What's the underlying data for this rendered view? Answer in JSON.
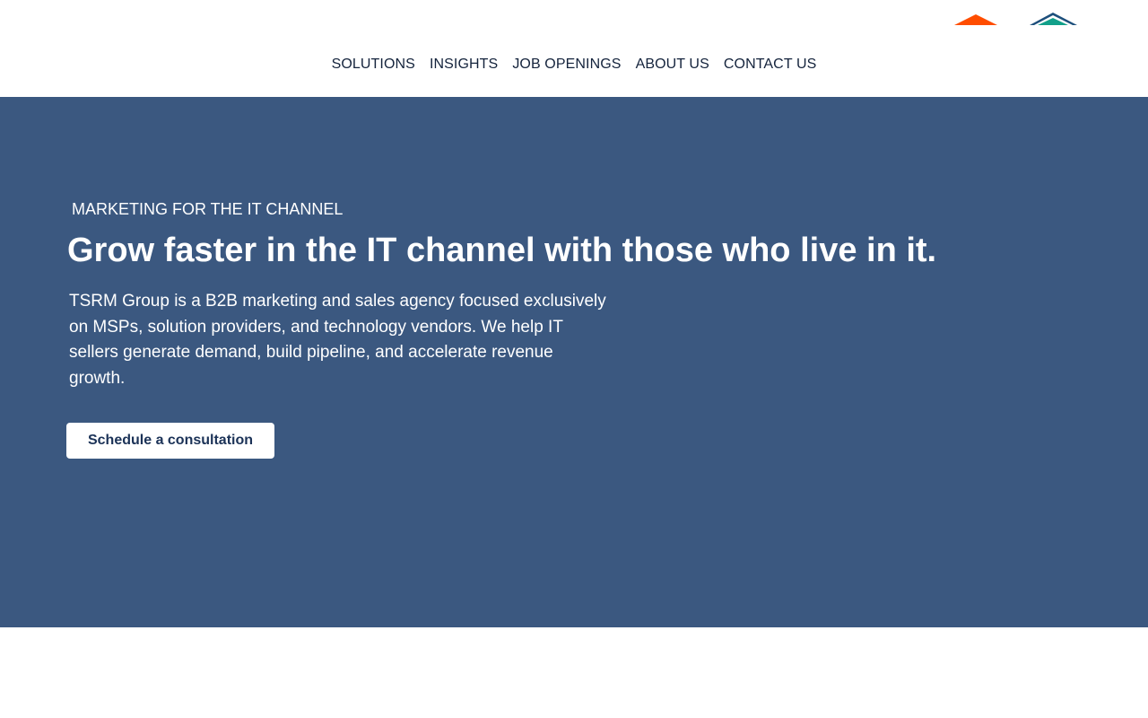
{
  "header": {
    "logo_icons": [
      "orange-roof-icon",
      "teal-roof-icon"
    ],
    "nav": [
      {
        "label": "SOLUTIONS"
      },
      {
        "label": "INSIGHTS"
      },
      {
        "label": "JOB OPENINGS"
      },
      {
        "label": "ABOUT US"
      },
      {
        "label": "CONTACT US"
      }
    ]
  },
  "hero": {
    "eyebrow": "MARKETING FOR THE IT CHANNEL",
    "headline": "Grow faster in the IT channel with those who live in it.",
    "description": "TSRM Group is a B2B marketing and sales agency focused exclusively on MSPs, solution providers, and technology vendors. We help IT sellers generate demand,  build pipeline, and accelerate revenue growth.",
    "cta_label": "Schedule a consultation"
  },
  "colors": {
    "hero_background": "#3b5880",
    "nav_text": "#14233c",
    "cta_text": "#1b3257",
    "logo_orange": "#ff4d00",
    "logo_navy": "#1d4f7c",
    "logo_teal": "#12a08a"
  }
}
